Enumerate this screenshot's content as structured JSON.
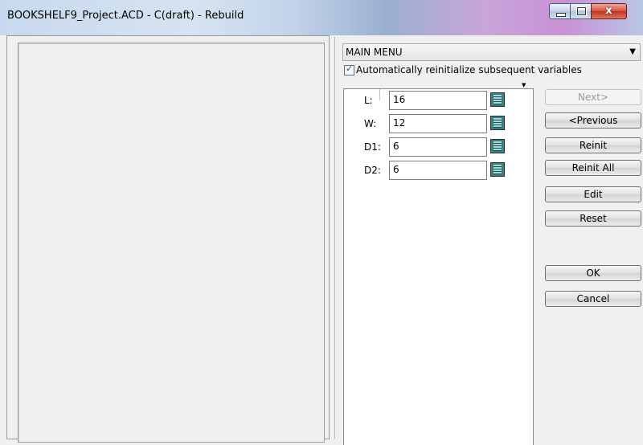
{
  "window": {
    "title": "BOOKSHELF9_Project.ACD - C(draft) - Rebuild",
    "caption_close_glyph": "x"
  },
  "main_menu": {
    "selected": "MAIN MENU"
  },
  "auto_reinit": {
    "label": "Automatically reinitialize subsequent variables",
    "checked": true
  },
  "variables": [
    {
      "label": "L:",
      "value": "16"
    },
    {
      "label": "W:",
      "value": "12"
    },
    {
      "label": "D1:",
      "value": "6"
    },
    {
      "label": "D2:",
      "value": "6"
    }
  ],
  "buttons": {
    "next": "Next>",
    "previous": "<Previous",
    "reinit": "Reinit",
    "reinit_all": "Reinit All",
    "edit": "Edit",
    "reset": "Reset",
    "ok": "OK",
    "cancel": "Cancel"
  },
  "icons": {
    "calculator": "calculator-icon",
    "dropdown": "chevron-down-icon",
    "check": "checkmark-icon"
  }
}
